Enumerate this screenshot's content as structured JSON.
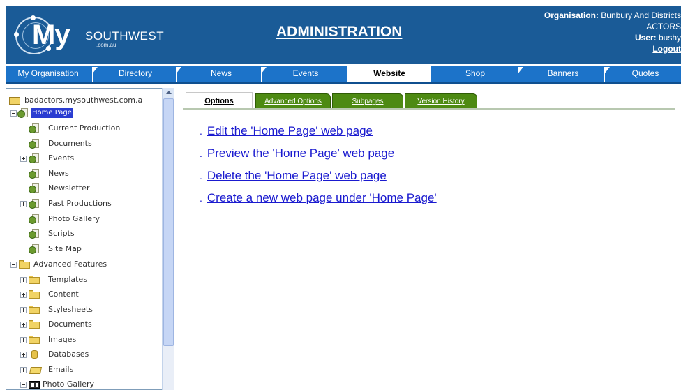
{
  "header": {
    "logo_my": "My",
    "logo_south": "SOUTHWEST",
    "logo_domain": ".com.au",
    "title": "ADMINISTRATION",
    "org_label": "Organisation:",
    "org_value_line1": "Bunbury And Districts",
    "org_value_line2": "ACTORS",
    "user_label": "User:",
    "user_value": "bushy",
    "logout": "Logout"
  },
  "nav": {
    "items": [
      "My Organisation",
      "Directory",
      "News",
      "Events",
      "Website",
      "Shop",
      "Banners",
      "Quotes"
    ],
    "active": "Website"
  },
  "tree": {
    "root": "badactors.mysouthwest.com.a",
    "selected": "Home Page",
    "home_children": [
      "Current Production",
      "Documents",
      "Events",
      "News",
      "Newsletter",
      "Past Productions",
      "Photo Gallery",
      "Scripts",
      "Site Map"
    ],
    "advanced": "Advanced Features",
    "advanced_children": [
      "Templates",
      "Content",
      "Stylesheets",
      "Documents",
      "Images",
      "Databases",
      "Emails",
      "Photo Gallery"
    ]
  },
  "tabs": {
    "items": [
      "Options",
      "Advanced Options",
      "Subpages",
      "Version History"
    ],
    "active": "Options"
  },
  "actions": [
    "Edit the 'Home Page' web page",
    "Preview the 'Home Page' web page",
    "Delete the 'Home Page' web page",
    "Create a new web page under 'Home Page'"
  ],
  "colors": {
    "header_bg": "#1a5b97",
    "nav_bg": "#1c73c9",
    "tab_green": "#4d8a12",
    "link": "#1a1acf",
    "selection": "#2a3cd1"
  }
}
